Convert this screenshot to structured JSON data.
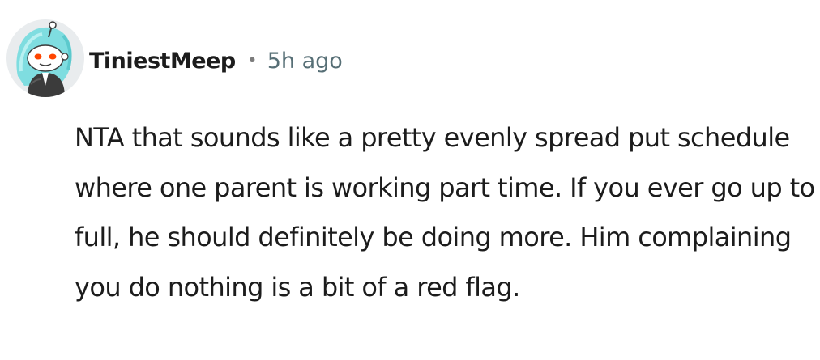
{
  "comment": {
    "username": "TiniestMeep",
    "separator": "•",
    "timestamp": "5h ago",
    "text": "NTA that sounds like a pretty evenly spread put schedule where one parent is working part time. If you ever go up to full, he should definitely be doing more. Him complaining you do nothing is a bit of a red flag."
  },
  "avatar": {
    "icon": "user-avatar-icon",
    "colors": {
      "background": "#e9ecee",
      "hair": "#7fdde0",
      "face": "#ffffff",
      "eyes": "#ff4500",
      "outfit": "#3b3b3b"
    }
  },
  "colors": {
    "text": "#1c1c1c",
    "meta": "#576f76"
  }
}
